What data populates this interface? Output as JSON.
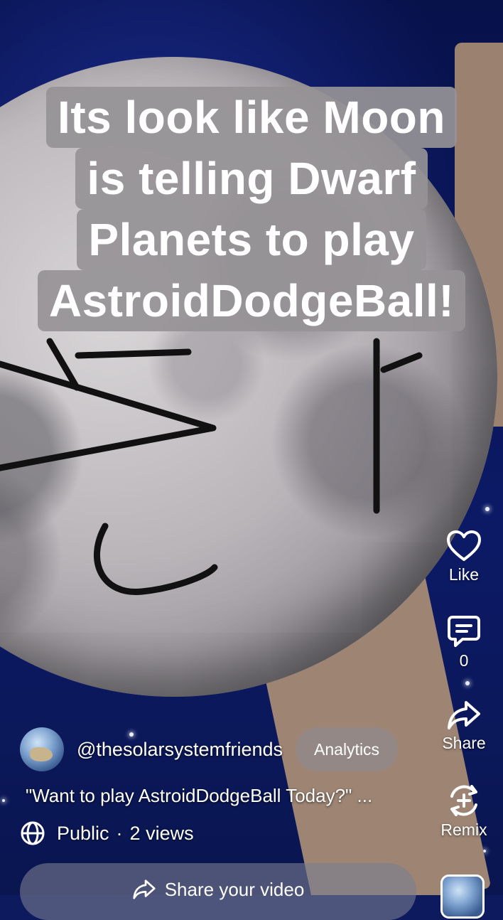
{
  "video": {
    "caption_lines": [
      "Its look like Moon",
      "is telling Dwarf",
      "Planets to play",
      "AstroidDodgeBall!"
    ]
  },
  "actions": {
    "like_label": "Like",
    "comment_count": "0",
    "share_label": "Share",
    "remix_label": "Remix"
  },
  "channel": {
    "handle": "@thesolarsystemfriends",
    "analytics_label": "Analytics"
  },
  "description": "\"Want to play AstroidDodgeBall Today?\" ...",
  "visibility": {
    "label": "Public",
    "separator": "·",
    "views": "2 views"
  },
  "share_bar": {
    "label": "Share your video"
  },
  "icons": {
    "like": "heart-icon",
    "comment": "comment-icon",
    "share": "share-arrow-icon",
    "remix": "remix-icon",
    "visibility": "globe-icon"
  }
}
